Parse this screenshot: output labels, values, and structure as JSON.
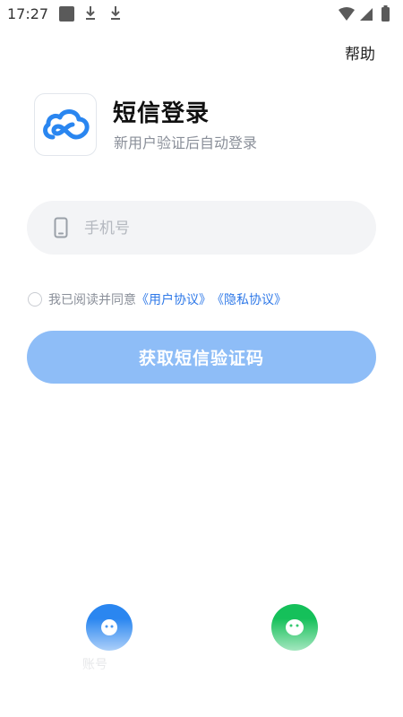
{
  "status_bar": {
    "time": "17:27"
  },
  "header": {
    "help_label": "帮助"
  },
  "login": {
    "title": "短信登录",
    "subtitle": "新用户验证后自动登录",
    "phone_placeholder": "手机号",
    "agreement_prefix": "我已阅读并同意",
    "user_agreement": "《用户协议》",
    "privacy_agreement": "《隐私协议》",
    "submit_label": "获取短信验证码"
  },
  "bottom": {
    "account_label": "账号",
    "account_icon": "account-icon",
    "wechat_icon": "wechat-icon"
  },
  "colors": {
    "brand_blue": "#2a86f0",
    "button_disabled": "#8ebdf7",
    "link": "#2f79e8",
    "wechat_green": "#15c05a"
  }
}
